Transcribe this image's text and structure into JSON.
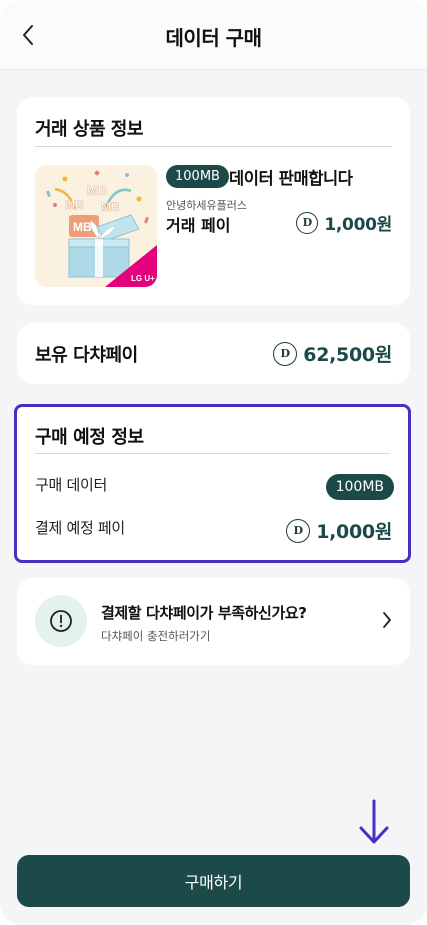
{
  "header": {
    "title": "데이터 구매",
    "back_icon": "chevron-left-icon"
  },
  "product_card": {
    "title": "거래 상품 정보",
    "badge": "100MB",
    "product_title": "데이터 판매합니다",
    "seller": "안녕하세유플러스",
    "pay_label": "거래 페이",
    "amount": "1,000원",
    "coin_symbol": "D",
    "thumbnail": {
      "mb_texts": [
        "MB",
        "MB",
        "MB",
        "MB"
      ],
      "brand_tag": "LG U+"
    }
  },
  "wallet_card": {
    "label": "보유 다챠페이",
    "amount": "62,500원",
    "coin_symbol": "D"
  },
  "purchase_card": {
    "title": "구매 예정 정보",
    "data_label": "구매 데이터",
    "data_value": "100MB",
    "pay_label": "결제 예정 페이",
    "pay_amount": "1,000원",
    "coin_symbol": "D"
  },
  "charge_card": {
    "title": "결제할 다챠페이가 부족하신가요?",
    "subtitle": "다챠페이 충전하러가기",
    "icon": "exclamation-circle-icon"
  },
  "buy_button": {
    "label": "구매하기"
  },
  "colors": {
    "primary": "#1c4a49",
    "highlight_border": "#4a2ec2",
    "background": "#f4f5f7",
    "brand_pink": "#e5007e"
  }
}
